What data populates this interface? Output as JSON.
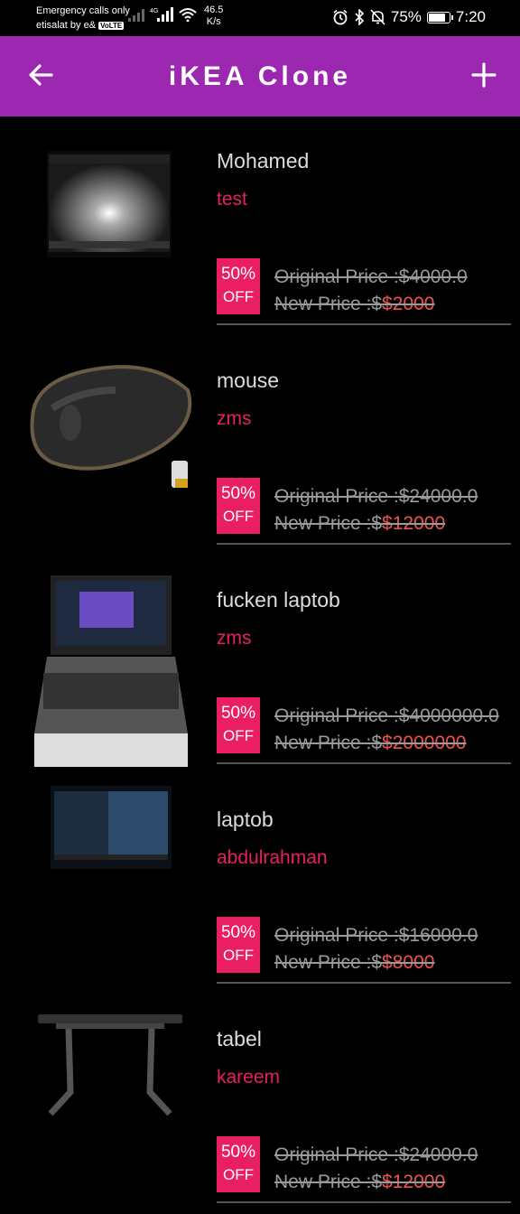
{
  "status": {
    "line1": "Emergency calls only",
    "carrier": "etisalat by e&",
    "volte": "VoLTE",
    "speed_value": "46.5",
    "speed_unit": "K/s",
    "battery": "75%",
    "time": "7:20"
  },
  "app_bar": {
    "title": "iKEA Clone"
  },
  "colors": {
    "app_bar": "#9c27b0",
    "accent": "#e91e63",
    "new_price": "#ef5350"
  },
  "items": [
    {
      "name": "Mohamed",
      "owner": "test",
      "discount": "50%",
      "off": "OFF",
      "original": "Original Price :$4000.0",
      "new_prefix": "New Price :$",
      "new_value": "$2000"
    },
    {
      "name": "mouse",
      "owner": "zms",
      "discount": "50%",
      "off": "OFF",
      "original": "Original Price :$24000.0",
      "new_prefix": "New Price :$",
      "new_value": "$12000"
    },
    {
      "name": "fucken laptob",
      "owner": "zms",
      "discount": "50%",
      "off": "OFF",
      "original": "Original Price :$4000000.0",
      "new_prefix": "New Price :$",
      "new_value": "$2000000"
    },
    {
      "name": "laptob",
      "owner": "abdulrahman",
      "discount": "50%",
      "off": "OFF",
      "original": "Original Price :$16000.0",
      "new_prefix": "New Price :$",
      "new_value": "$8000"
    },
    {
      "name": "tabel",
      "owner": "kareem",
      "discount": "50%",
      "off": "OFF",
      "original": "Original Price :$24000.0",
      "new_prefix": "New Price :$",
      "new_value": "$12000"
    }
  ]
}
